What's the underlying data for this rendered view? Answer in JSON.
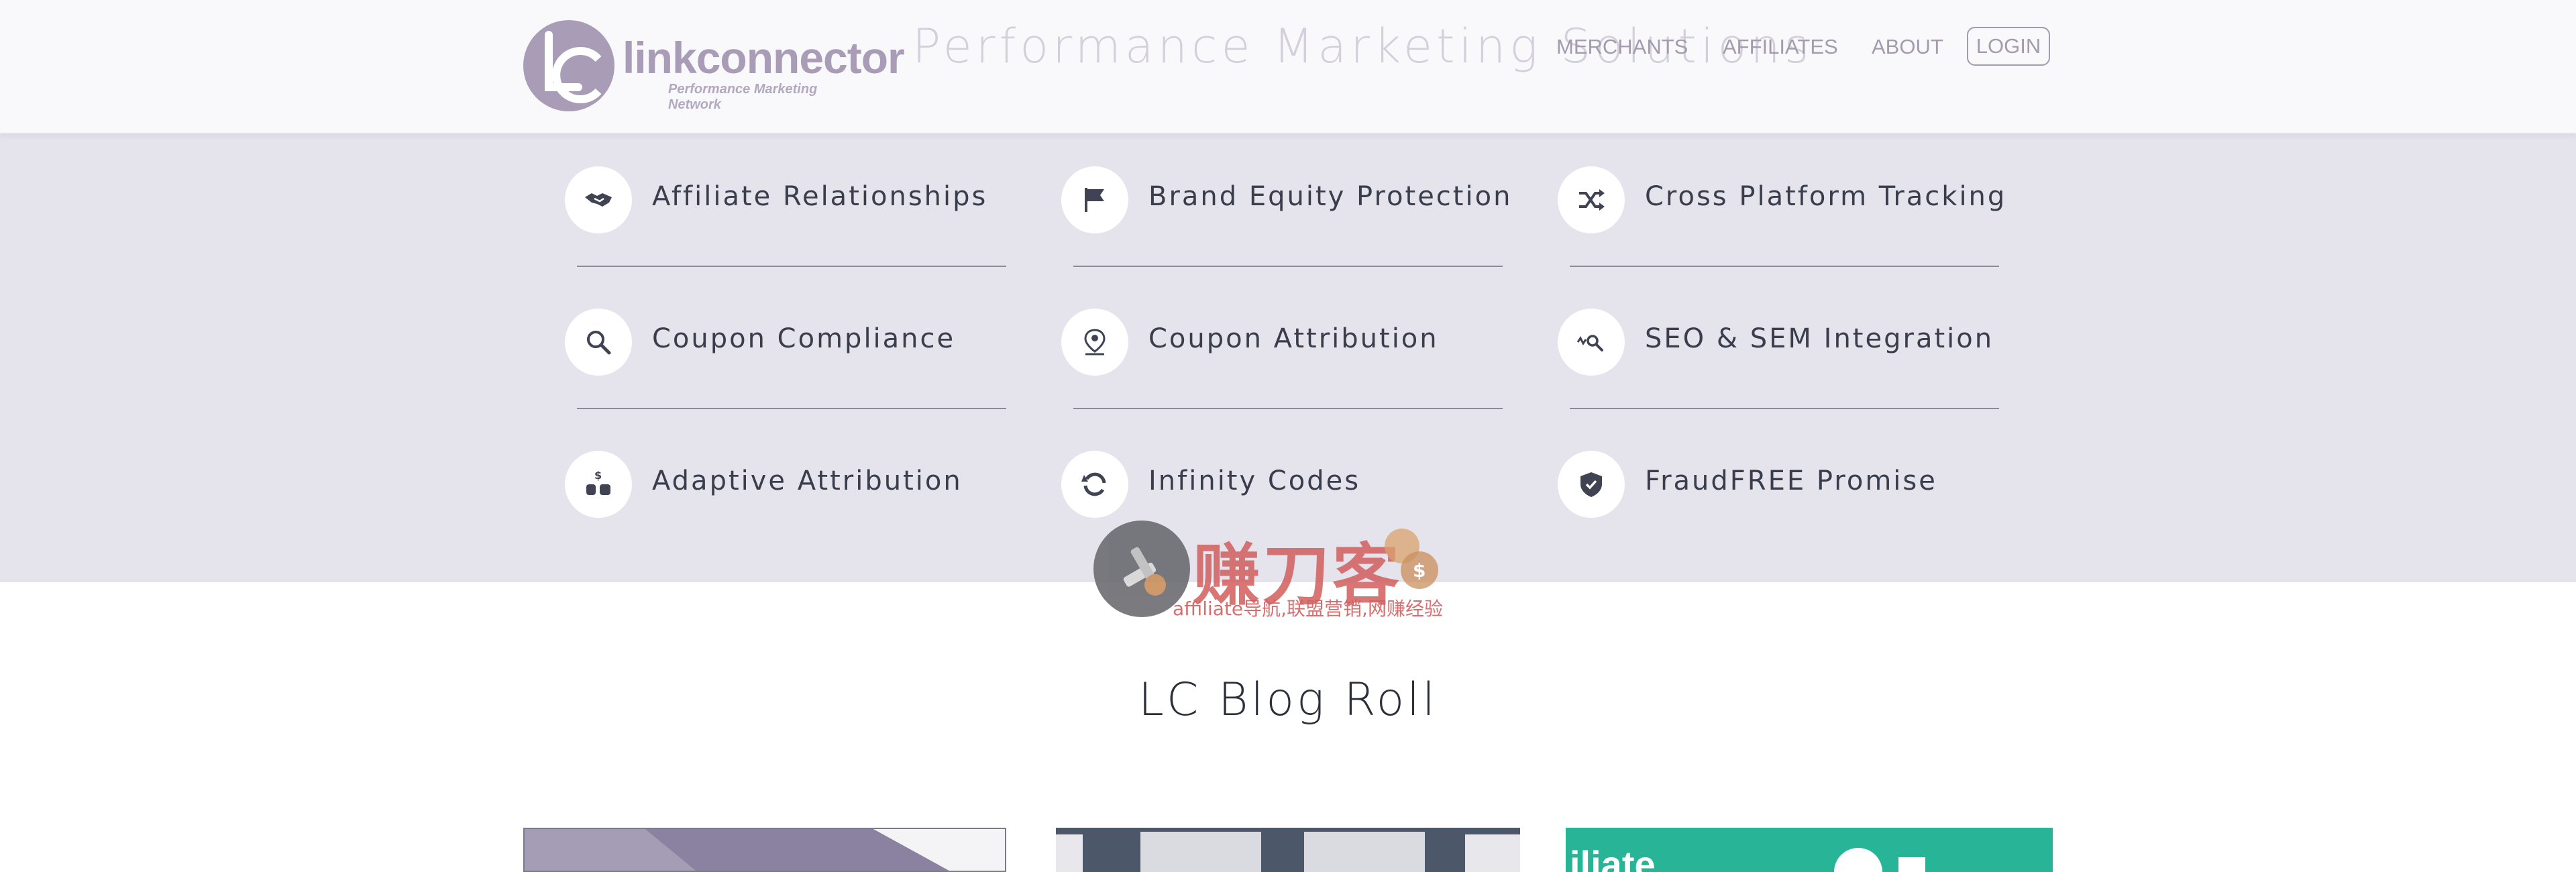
{
  "header": {
    "logo": {
      "wordmark": "linkconnector",
      "tagline": "Performance Marketing Network",
      "monogram": "LC"
    },
    "ghost_tagline": "Performance Marketing Solutions",
    "nav": [
      {
        "label": "MERCHANTS"
      },
      {
        "label": "AFFILIATES"
      },
      {
        "label": "ABOUT"
      }
    ],
    "login_label": "LOGIN"
  },
  "features": [
    {
      "label": "Affiliate Relationships",
      "icon": "handshake-icon"
    },
    {
      "label": "Brand Equity Protection",
      "icon": "flag-icon"
    },
    {
      "label": "Cross Platform Tracking",
      "icon": "shuffle-icon"
    },
    {
      "label": "Coupon Compliance",
      "icon": "magnifier-icon"
    },
    {
      "label": "Coupon Attribution",
      "icon": "map-pin-icon"
    },
    {
      "label": "SEO & SEM Integration",
      "icon": "search-analytics-icon"
    },
    {
      "label": "Adaptive Attribution",
      "icon": "money-bags-icon"
    },
    {
      "label": "Infinity Codes",
      "icon": "refresh-icon"
    },
    {
      "label": "FraudFREE Promise",
      "icon": "shield-check-icon"
    }
  ],
  "watermark": {
    "chars": "赚刀客",
    "subtitle": "affiliate导航,联盟营销,网赚经验"
  },
  "blog": {
    "title": "LC Blog Roll",
    "cards": [
      {
        "visible_text": ""
      },
      {
        "visible_text": ""
      },
      {
        "visible_text": "iliate"
      }
    ]
  },
  "colors": {
    "header_bg": "#f9f9fb",
    "features_bg": "#e5e3ec",
    "brand_purple": "#a99cb7",
    "icon_dark": "#3f4352",
    "text_dark": "#3a3d4c"
  }
}
